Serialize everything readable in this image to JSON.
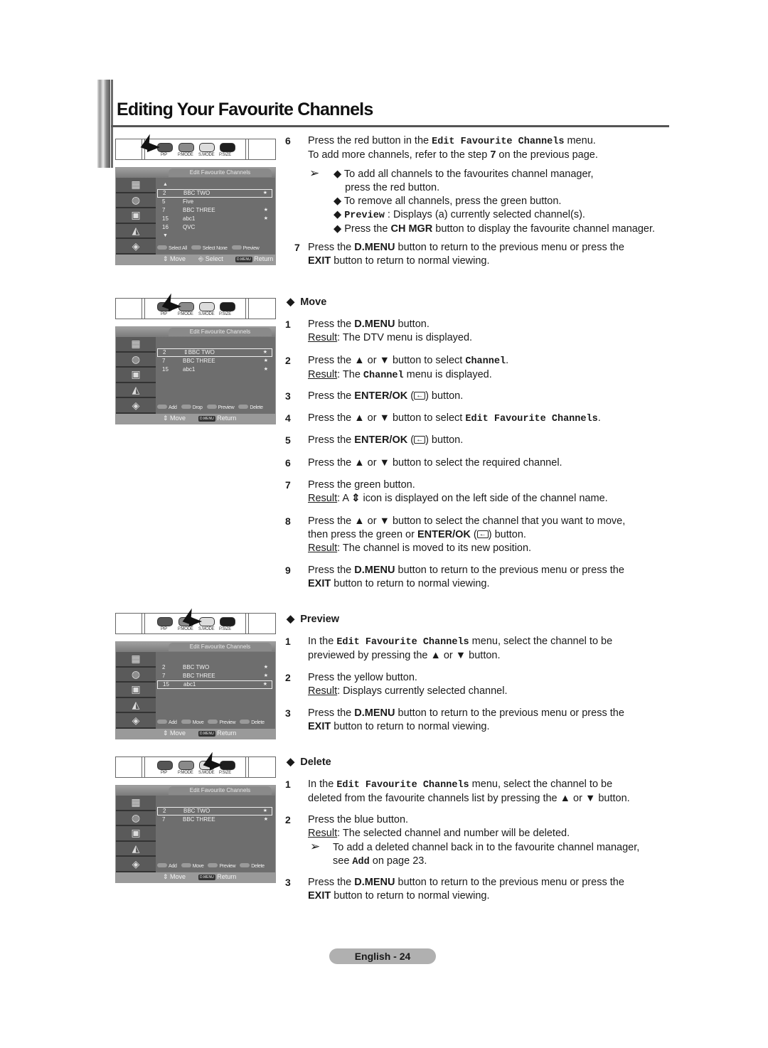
{
  "page": {
    "title": "Editing Your Favourite Channels",
    "footer": "English - 24"
  },
  "remote_labels": [
    "PIP",
    "P.MODE",
    "S.MODE",
    "P.SIZE"
  ],
  "menus": [
    {
      "title": "Edit Favourite Channels",
      "channels": [
        {
          "num": "2",
          "name": "BBC TWO",
          "star": "★",
          "selected": true
        },
        {
          "num": "5",
          "name": "Five",
          "star": ""
        },
        {
          "num": "7",
          "name": "BBC  THREE",
          "star": "★"
        },
        {
          "num": "15",
          "name": "abc1",
          "star": "★"
        },
        {
          "num": "16",
          "name": "QVC",
          "star": ""
        }
      ],
      "color_buttons": [
        "Select All",
        "Select None",
        "Preview"
      ],
      "footer": {
        "move": "Move",
        "select": "Select",
        "dmenu": "D.MENU",
        "return": "Return"
      }
    },
    {
      "title": "Edit Favourite Channels",
      "channels": [
        {
          "num": "2",
          "name": "⇕BBC TWO",
          "star": "★",
          "selected": true
        },
        {
          "num": "7",
          "name": "BBC THREE",
          "star": "★"
        },
        {
          "num": "15",
          "name": "abc1",
          "star": "★"
        }
      ],
      "color_buttons": [
        "Add",
        "Drop",
        "Preview",
        "Delete"
      ],
      "footer": {
        "move": "Move",
        "dmenu": "D.MENU",
        "return": "Return"
      }
    },
    {
      "title": "Edit Favourite Channels",
      "channels": [
        {
          "num": "2",
          "name": "BBC TWO",
          "star": "★"
        },
        {
          "num": "7",
          "name": "BBC THREE",
          "star": "★"
        },
        {
          "num": "15",
          "name": "abc1",
          "star": "★",
          "selected": true
        }
      ],
      "color_buttons": [
        "Add",
        "Move",
        "Preview",
        "Delete"
      ],
      "footer": {
        "move": "Move",
        "dmenu": "D.MENU",
        "return": "Return"
      }
    },
    {
      "title": "Edit Favourite Channels",
      "channels": [
        {
          "num": "2",
          "name": "BBC TWO",
          "star": "★",
          "selected": true
        },
        {
          "num": "7",
          "name": "BBC THREE",
          "star": "★"
        }
      ],
      "color_buttons": [
        "Add",
        "Move",
        "Preview",
        "Delete"
      ],
      "footer": {
        "move": "Move",
        "dmenu": "D.MENU",
        "return": "Return"
      }
    }
  ],
  "intro": {
    "s6": {
      "num": "6",
      "l1a": "Press the red button in the ",
      "l1code": "Edit Favourite Channels",
      "l1b": " menu.",
      "l2a": "To add more channels, refer to the step ",
      "l2b": "7",
      "l2c": " on the previous page.",
      "note_arrow": "➢",
      "bullets": {
        "b1a": "To add all channels to the favourites channel manager,",
        "b1b": "press the red button.",
        "b2": "To remove all channels, press the green button.",
        "b3code": "Preview",
        "b3": " : Displays (a) currently selected channel(s).",
        "b4a": "Press the ",
        "b4b": "CH MGR",
        "b4c": " button to display the favourite channel manager."
      }
    },
    "s7": {
      "num": "7",
      "a": "Press the ",
      "b": "D.MENU",
      "c": " button to return to the previous menu or press the",
      "d": "EXIT",
      "e": " button to return to normal viewing."
    }
  },
  "move": {
    "heading": "Move",
    "steps": {
      "s1": {
        "num": "1",
        "a": "Press the ",
        "b": "D.MENU",
        "c": " button.",
        "r": "Result",
        "rt": ": The DTV menu is displayed."
      },
      "s2": {
        "num": "2",
        "a": "Press the ▲ or ▼ button to select ",
        "code": "Channel",
        "c": ".",
        "r": "Result",
        "rt1": ": The ",
        "rcode": "Channel",
        "rt2": " menu is displayed."
      },
      "s3": {
        "num": "3",
        "a": "Press the ",
        "b": "ENTER/OK",
        "c": " (",
        "d": ") button."
      },
      "s4": {
        "num": "4",
        "a": "Press the ▲ or ▼ button to select ",
        "code": "Edit Favourite Channels",
        "c": "."
      },
      "s5": {
        "num": "5",
        "a": "Press the ",
        "b": "ENTER/OK",
        "c": " (",
        "d": ") button."
      },
      "s6": {
        "num": "6",
        "a": "Press the ▲ or ▼ button to select the required channel."
      },
      "s7": {
        "num": "7",
        "a": "Press the green button.",
        "r": "Result",
        "rt1": ": A ",
        "icon": "⇕",
        "rt2": " icon is displayed on the left side of the channel name."
      },
      "s8": {
        "num": "8",
        "a": "Press the ▲ or ▼ button to select the channel that you want to move,",
        "b1": "then press the green or ",
        "b2": "ENTER/OK",
        "b3": " (",
        "b4": ") button.",
        "r": "Result",
        "rt": ": The channel is moved to its new position."
      },
      "s9": {
        "num": "9",
        "a": "Press the ",
        "b": "D.MENU",
        "c": " button to return to the previous menu or press the",
        "d": "EXIT",
        "e": " button to return to normal viewing."
      }
    }
  },
  "preview": {
    "heading": "Preview",
    "steps": {
      "s1": {
        "num": "1",
        "a": "In the ",
        "code": "Edit Favourite Channels",
        "b": " menu, select the channel to be",
        "c": "previewed by pressing the ▲ or ▼ button."
      },
      "s2": {
        "num": "2",
        "a": "Press the yellow button.",
        "r": "Result",
        "rt": ": Displays currently selected channel."
      },
      "s3": {
        "num": "3",
        "a": "Press the ",
        "b": "D.MENU",
        "c": " button to return to the previous menu or press the",
        "d": "EXIT",
        "e": " button to return to normal viewing."
      }
    }
  },
  "delete": {
    "heading": "Delete",
    "steps": {
      "s1": {
        "num": "1",
        "a": "In the ",
        "code": "Edit Favourite Channels",
        "b": " menu, select the channel to be",
        "c": "deleted from the favourite channels list by pressing the ▲ or ▼ button."
      },
      "s2": {
        "num": "2",
        "a": "Press the blue button.",
        "r": "Result",
        "rt": ": The selected channel and number will be deleted.",
        "note_arrow": "➢",
        "n1": "To add a deleted channel back in to the favourite channel manager,",
        "n2a": "see ",
        "n2code": "Add",
        "n2b": " on page 23."
      },
      "s3": {
        "num": "3",
        "a": "Press the ",
        "b": "D.MENU",
        "c": " button to return to the previous menu or press the",
        "d": "EXIT",
        "e": " button to return to normal viewing."
      }
    }
  },
  "colors": {
    "menu_bg": "#6e6e6e",
    "footer_pill": "#b0b0b0",
    "rule": "#555555"
  }
}
